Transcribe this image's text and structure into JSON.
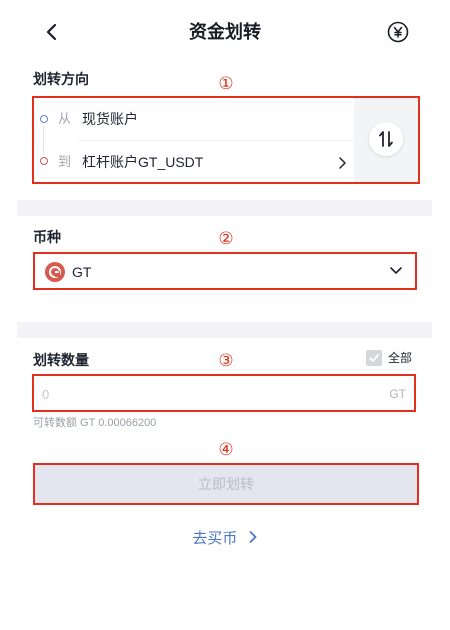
{
  "header": {
    "title": "资金划转",
    "back_icon": "chevron-left-icon",
    "currency_icon": "yen-currency-icon"
  },
  "direction": {
    "label": "划转方向",
    "annotation": "①",
    "from_prefix": "从",
    "from_account": "现货账户",
    "to_prefix": "到",
    "to_account": "杠杆账户GT_USDT",
    "swap_icon": "swap-vertical-icon"
  },
  "coin": {
    "label": "币种",
    "annotation": "②",
    "selected": "GT",
    "logo_icon": "gatetoken-logo-icon"
  },
  "amount": {
    "label": "划转数量",
    "annotation": "③",
    "all_label": "全部",
    "placeholder": "0",
    "unit": "GT",
    "available_text": "可转数额 GT 0.00066200"
  },
  "submit": {
    "annotation": "④",
    "label": "立即划转"
  },
  "buy_link": {
    "label": "去买币"
  },
  "colors": {
    "annotation_red": "#e2301c",
    "link_blue": "#4a74c9",
    "disabled_button": "#e4e6ef"
  }
}
